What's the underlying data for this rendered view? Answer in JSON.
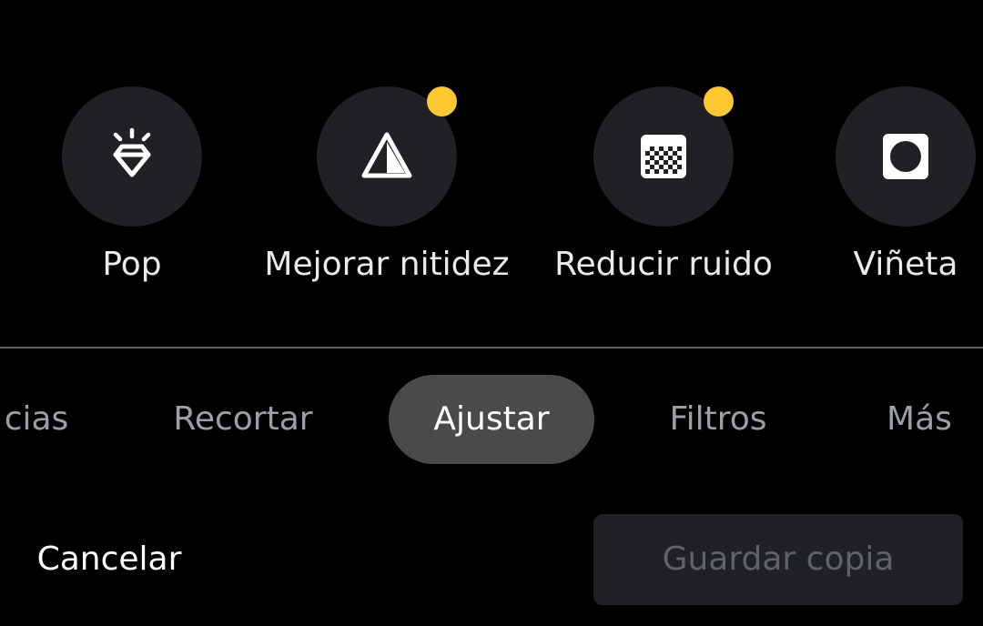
{
  "colors": {
    "background": "#000000",
    "tool_circle": "#202124",
    "badge": "#fdc82f",
    "active_tab_bg": "#4a4a4a",
    "inactive_tab_text": "#9aa0a6",
    "disabled_button_text": "#5f6368"
  },
  "tools": [
    {
      "label": "Pop",
      "icon": "diamond-sparkle-icon",
      "badge": false
    },
    {
      "label": "Mejorar nitidez",
      "icon": "sharpen-triangle-icon",
      "badge": true
    },
    {
      "label": "Reducir ruido",
      "icon": "denoise-grid-icon",
      "badge": true
    },
    {
      "label": "Viñeta",
      "icon": "vignette-icon",
      "badge": false
    }
  ],
  "tabs": {
    "items": [
      "cias",
      "Recortar",
      "Ajustar",
      "Filtros",
      "Más"
    ],
    "active": "Ajustar"
  },
  "actions": {
    "cancel": "Cancelar",
    "save_copy": "Guardar copia"
  }
}
